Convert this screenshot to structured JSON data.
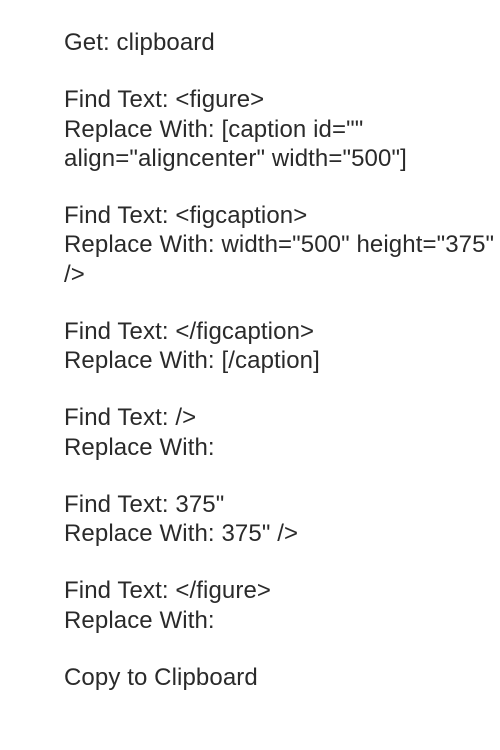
{
  "header": {
    "get_label": "Get:",
    "get_value": "clipboard"
  },
  "replacements": [
    {
      "find_label": "Find Text:",
      "find_value": "<figure>",
      "replace_label": "Replace With:",
      "replace_value": "[caption id=\"\" align=\"aligncenter\" width=\"500\"]"
    },
    {
      "find_label": "Find Text:",
      "find_value": "<figcaption>",
      "replace_label": "Replace With:",
      "replace_value": "width=\"500\" height=\"375\" />"
    },
    {
      "find_label": "Find Text:",
      "find_value": "</figcaption>",
      "replace_label": "Replace With:",
      "replace_value": "[/caption]"
    },
    {
      "find_label": "Find Text:",
      "find_value": "/>",
      "replace_label": "Replace With:",
      "replace_value": ""
    },
    {
      "find_label": "Find Text:",
      "find_value": "375\"",
      "replace_label": "Replace With:",
      "replace_value": "375\" />"
    },
    {
      "find_label": "Find Text:",
      "find_value": "</figure>",
      "replace_label": "Replace With:",
      "replace_value": ""
    }
  ],
  "footer": {
    "copy_label": "Copy to Clipboard"
  }
}
